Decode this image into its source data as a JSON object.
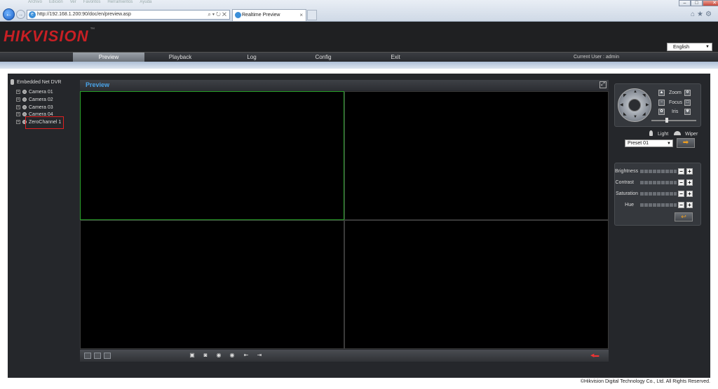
{
  "browser": {
    "url": "http://192.168.1.200:90/doc/en/preview.asp",
    "tab_title": "Realtime Preview",
    "tab_close": "×",
    "addr_tools": "⌕▾↻✕",
    "menu_items": [
      "Archivo",
      "Edición",
      "Ver",
      "Favoritos",
      "Herramientos",
      "Ayuda"
    ],
    "back_glyph": "←",
    "fwd_glyph": "→",
    "right_icons": "⌂★⚙"
  },
  "app": {
    "logo": "HIKVISION",
    "logo_tm": "™",
    "language": "English",
    "language_arrow": "▼",
    "current_user": "Current User : admin"
  },
  "nav": [
    {
      "label": "Preview",
      "active": true
    },
    {
      "label": "Playback",
      "active": false
    },
    {
      "label": "Log",
      "active": false
    },
    {
      "label": "Config",
      "active": false
    },
    {
      "label": "Exit",
      "active": false
    }
  ],
  "tree": {
    "root": "Embedded Net DVR",
    "expand_glyph": "+",
    "cameras": [
      "Camera 01",
      "Camera 02",
      "Camera 03",
      "Camera 04",
      "ZeroChannel 1"
    ]
  },
  "preview": {
    "title": "Preview",
    "fullscreen_glyph": "⤢",
    "selected_cell": 0
  },
  "ptz": {
    "zoom": "Zoom",
    "focus": "Focus",
    "iris": "Iris",
    "light": "Light",
    "wiper": "Wiper",
    "preset": "Preset 01",
    "preset_arrow": "▼",
    "goto_glyph": "➡",
    "speed_fraction": 0.35
  },
  "image": {
    "params": [
      "Brightness",
      "Contrast",
      "Saturation",
      "Hue"
    ],
    "minus": "−",
    "plus": "+",
    "reset_glyph": "↩"
  },
  "footer": "©Hikvision Digital Technology Co., Ltd. All Rights Reserved.",
  "colors": {
    "brand_red": "#c81f24",
    "accent_blue": "#4aa3e8",
    "selection_green": "#2aa12a",
    "highlight_red": "#e02020"
  }
}
